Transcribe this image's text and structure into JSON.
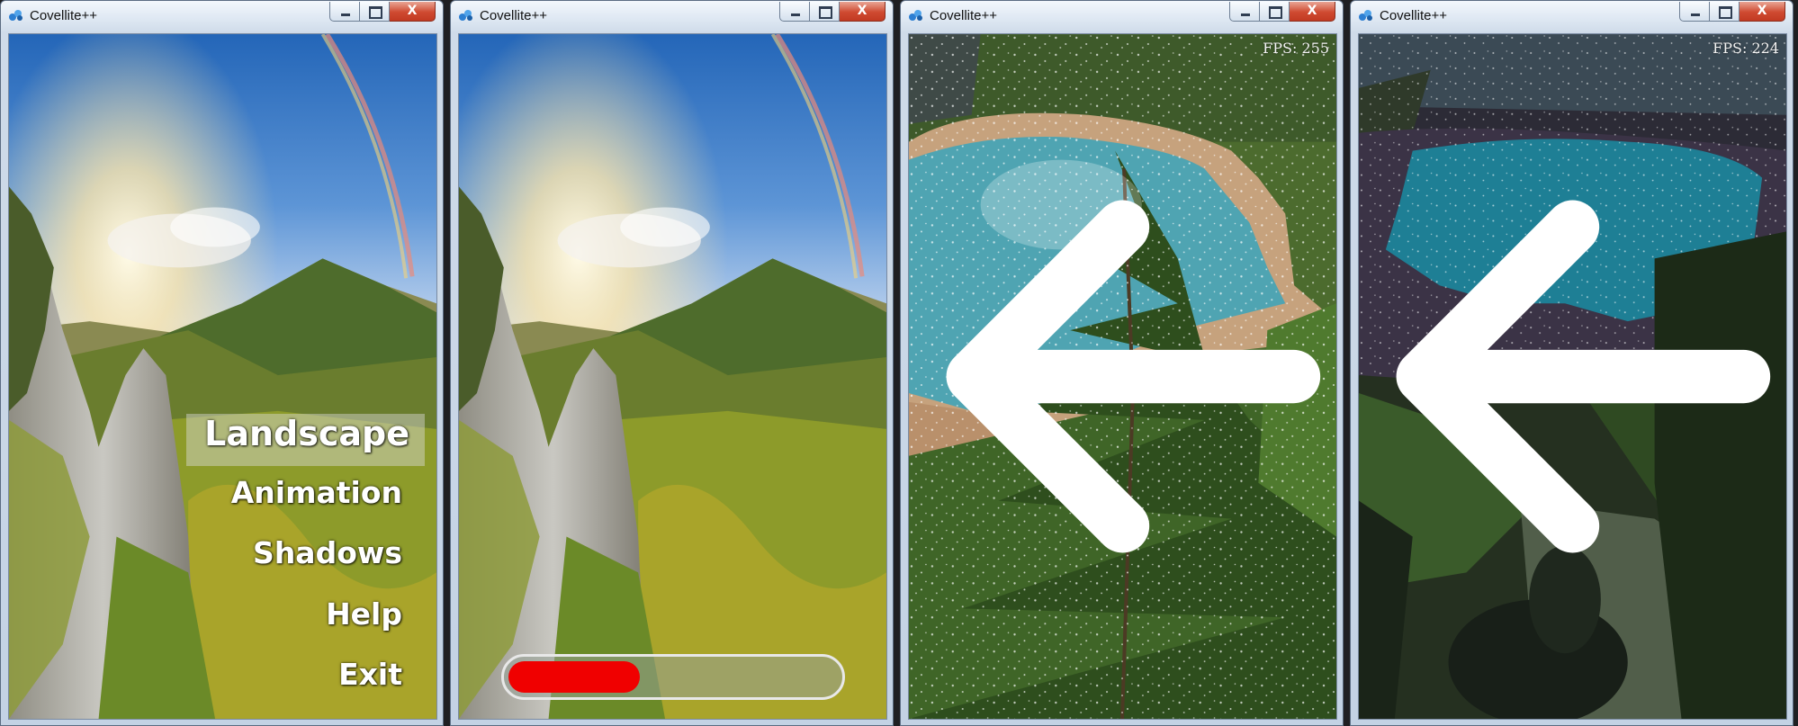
{
  "windows": [
    {
      "id": "menu",
      "title": "Covellite++",
      "close_glyph": "X",
      "icon": "app-logo-icon"
    },
    {
      "id": "loading",
      "title": "Covellite++",
      "close_glyph": "X",
      "icon": "app-logo-icon"
    },
    {
      "id": "landscape",
      "title": "Covellite++",
      "close_glyph": "X",
      "icon": "app-logo-icon"
    },
    {
      "id": "shadows",
      "title": "Covellite++",
      "close_glyph": "X",
      "icon": "app-logo-icon"
    }
  ],
  "menu": {
    "items": [
      "Landscape",
      "Animation",
      "Shadows",
      "Help",
      "Exit"
    ],
    "selected": "Landscape"
  },
  "loading": {
    "progress": 0.4
  },
  "landscape": {
    "fps": "FPS: 255",
    "back_icon": "back-arrow-icon"
  },
  "shadows": {
    "fps": "FPS: 224",
    "back_icon": "back-arrow-icon"
  },
  "colors": {
    "progress_fill": "#f00000",
    "menu_text": "#ffffff",
    "close_button": "#cf4a31"
  }
}
